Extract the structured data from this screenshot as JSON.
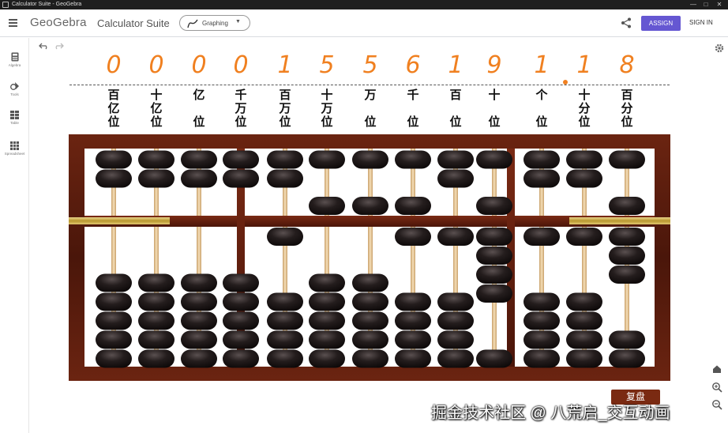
{
  "window": {
    "title": "Calculator Suite - GeoGebra",
    "controls": [
      "—",
      "□",
      "✕"
    ]
  },
  "appbar": {
    "brand": "GeoGebra",
    "suite": "Calculator Suite",
    "mode": "Graphing",
    "assign_label": "ASSIGN",
    "signin_label": "SIGN IN"
  },
  "sidebar": {
    "items": [
      {
        "label": "Algebra",
        "icon": "calculator-icon"
      },
      {
        "label": "Tools",
        "icon": "tools-icon"
      },
      {
        "label": "Table",
        "icon": "table-icon"
      },
      {
        "label": "Spreadsheet",
        "icon": "spreadsheet-icon"
      }
    ]
  },
  "digits": [
    "0",
    "0",
    "0",
    "0",
    "1",
    "5",
    "5",
    "6",
    "1",
    "9",
    "1",
    "1",
    "8"
  ],
  "places": [
    [
      "百",
      "亿",
      "位"
    ],
    [
      "十",
      "亿",
      "位"
    ],
    [
      "亿",
      "",
      "位"
    ],
    [
      "千",
      "万",
      "位"
    ],
    [
      "百",
      "万",
      "位"
    ],
    [
      "十",
      "万",
      "位"
    ],
    [
      "万",
      "",
      "位"
    ],
    [
      "千",
      "",
      "位"
    ],
    [
      "百",
      "",
      "位"
    ],
    [
      "十",
      "",
      "位"
    ],
    [
      "个",
      "",
      "位"
    ],
    [
      "十",
      "分",
      "位"
    ],
    [
      "百",
      "分",
      "位"
    ]
  ],
  "replay_label": "复盘",
  "watermark": "掘金技术社区 @ 八荒启_交互动画",
  "colors": {
    "digit": "#f08020",
    "frame": "#5a1c0c",
    "bead": "#1a1616",
    "rod": "#e8c99a",
    "assign": "#6557d2"
  }
}
